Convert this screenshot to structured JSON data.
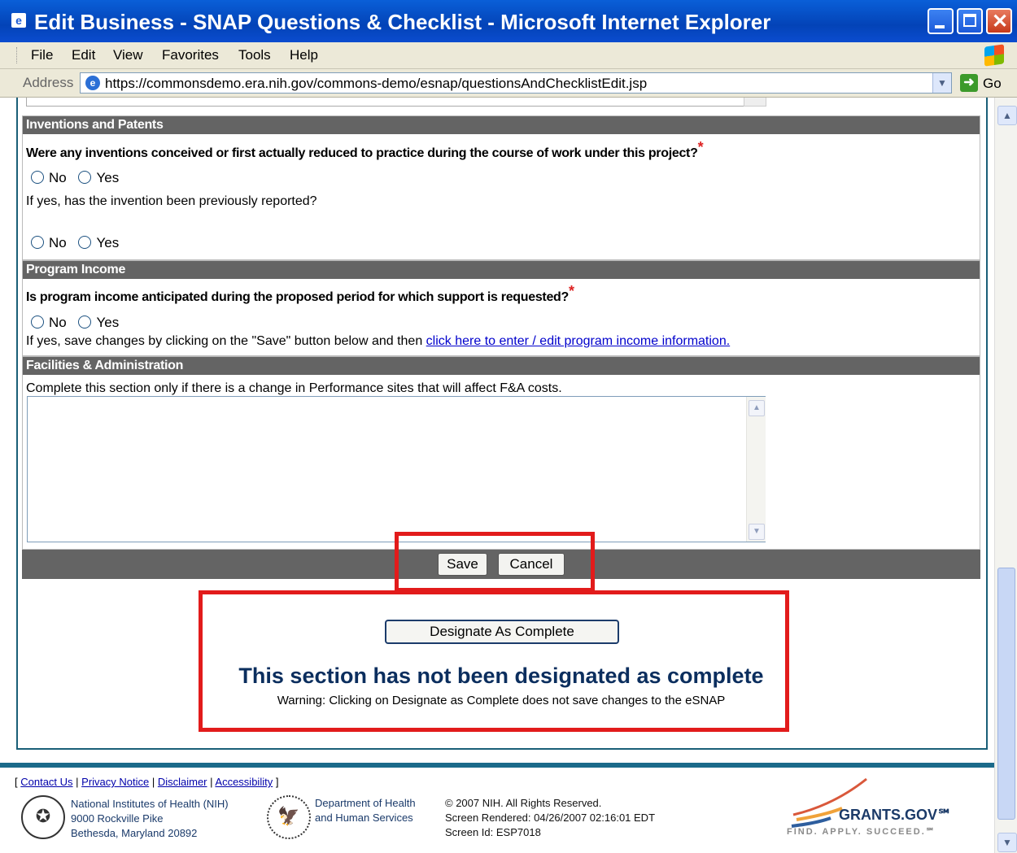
{
  "window": {
    "title": "Edit Business - SNAP Questions & Checklist - Microsoft Internet Explorer",
    "minimize": "",
    "close": "✕"
  },
  "menu": [
    "File",
    "Edit",
    "View",
    "Favorites",
    "Tools",
    "Help"
  ],
  "address": {
    "label": "Address",
    "url": "https://commonsdemo.era.nih.gov/commons-demo/esnap/questionsAndChecklistEdit.jsp",
    "go": "Go"
  },
  "inventions": {
    "header": "Inventions and Patents",
    "question": "Were any inventions conceived or first actually reduced to practice during the course of work under this project?",
    "required": "*",
    "no": "No",
    "yes": "Yes",
    "followup": "If yes, has the invention been previously reported?"
  },
  "program_income": {
    "header": "Program Income",
    "question": "Is program income anticipated during the proposed period for which support is requested?",
    "required": "*",
    "no": "No",
    "yes": "Yes",
    "note": "If yes, save changes by clicking on the \"Save\" button below and then",
    "link": "click here to enter / edit program income information."
  },
  "facilities": {
    "header": "Facilities & Administration",
    "note": "Complete this section only if there is a change in Performance sites that will affect F&A costs.",
    "value": ""
  },
  "actions": {
    "save": "Save",
    "cancel": "Cancel",
    "designate": "Designate As Complete",
    "status": "This section has not been designated as complete",
    "warning": "Warning: Clicking on Designate as Complete does not save changes to the eSNAP"
  },
  "footer": {
    "links": [
      "Contact Us",
      "Privacy Notice",
      "Disclaimer",
      "Accessibility"
    ],
    "nih": [
      "National Institutes of Health (NIH)",
      "9000 Rockville Pike",
      "Bethesda, Maryland 20892"
    ],
    "hhs": [
      "Department of Health",
      "and Human Services"
    ],
    "info": [
      "© 2007 NIH. All Rights Reserved.",
      "Screen Rendered: 04/26/2007 02:16:01 EDT",
      "Screen Id: ESP7018"
    ],
    "grants_brand": "GRANTS.GOV℠",
    "grants_tagline": "FIND. APPLY. SUCCEED.℠"
  },
  "colors": {
    "section_header": "#646464",
    "highlight": "#e21b1b",
    "status_text": "#0b2e5e",
    "frame": "#1a5f78"
  }
}
